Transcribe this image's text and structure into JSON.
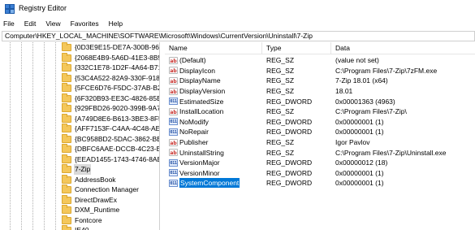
{
  "window": {
    "title": "Registry Editor"
  },
  "menu": [
    "File",
    "Edit",
    "View",
    "Favorites",
    "Help"
  ],
  "address": "Computer\\HKEY_LOCAL_MACHINE\\SOFTWARE\\Microsoft\\Windows\\CurrentVersion\\Uninstall\\7-Zip",
  "tree": {
    "items": [
      {
        "label": "{0D3E9E15-DE7A-300B-96F",
        "selected": false
      },
      {
        "label": "{2068E4B9-5A6D-41E3-8B50",
        "selected": false
      },
      {
        "label": "{332C1E78-1D2F-4A64-B718",
        "selected": false
      },
      {
        "label": "{53C4A522-82A9-330F-9187",
        "selected": false
      },
      {
        "label": "{5FCE6D76-F5DC-37AB-B2EE",
        "selected": false
      },
      {
        "label": "{6F320B93-EE3C-4826-85E0",
        "selected": false
      },
      {
        "label": "{929FBD26-9020-399B-9A7A",
        "selected": false
      },
      {
        "label": "{A749D8E6-B613-3BE3-8F5F",
        "selected": false
      },
      {
        "label": "{AFF7153F-C4AA-4C48-AEE",
        "selected": false
      },
      {
        "label": "{BC958BD2-5DAC-3862-BB1",
        "selected": false
      },
      {
        "label": "{DBFC6AAE-DCCB-4C23-B0",
        "selected": false
      },
      {
        "label": "{EEAD1455-1743-4746-8AEA",
        "selected": false
      },
      {
        "label": "7-Zip",
        "selected": true
      },
      {
        "label": "AddressBook",
        "selected": false
      },
      {
        "label": "Connection Manager",
        "selected": false
      },
      {
        "label": "DirectDrawEx",
        "selected": false
      },
      {
        "label": "DXM_Runtime",
        "selected": false
      },
      {
        "label": "Fontcore",
        "selected": false
      },
      {
        "label": "IE40",
        "selected": false
      }
    ]
  },
  "list": {
    "columns": {
      "name": "Name",
      "type": "Type",
      "data": "Data"
    },
    "rows": [
      {
        "icon": "string-value-icon",
        "name": "(Default)",
        "type": "REG_SZ",
        "data": "(value not set)",
        "selected": false
      },
      {
        "icon": "string-value-icon",
        "name": "DisplayIcon",
        "type": "REG_SZ",
        "data": "C:\\Program Files\\7-Zip\\7zFM.exe",
        "selected": false
      },
      {
        "icon": "string-value-icon",
        "name": "DisplayName",
        "type": "REG_SZ",
        "data": "7-Zip 18.01 (x64)",
        "selected": false
      },
      {
        "icon": "string-value-icon",
        "name": "DisplayVersion",
        "type": "REG_SZ",
        "data": "18.01",
        "selected": false
      },
      {
        "icon": "dword-value-icon",
        "name": "EstimatedSize",
        "type": "REG_DWORD",
        "data": "0x00001363 (4963)",
        "selected": false
      },
      {
        "icon": "string-value-icon",
        "name": "InstallLocation",
        "type": "REG_SZ",
        "data": "C:\\Program Files\\7-Zip\\",
        "selected": false
      },
      {
        "icon": "dword-value-icon",
        "name": "NoModify",
        "type": "REG_DWORD",
        "data": "0x00000001 (1)",
        "selected": false
      },
      {
        "icon": "dword-value-icon",
        "name": "NoRepair",
        "type": "REG_DWORD",
        "data": "0x00000001 (1)",
        "selected": false
      },
      {
        "icon": "string-value-icon",
        "name": "Publisher",
        "type": "REG_SZ",
        "data": "Igor Pavlov",
        "selected": false
      },
      {
        "icon": "string-value-icon",
        "name": "UninstallString",
        "type": "REG_SZ",
        "data": "C:\\Program Files\\7-Zip\\Uninstall.exe",
        "selected": false
      },
      {
        "icon": "dword-value-icon",
        "name": "VersionMajor",
        "type": "REG_DWORD",
        "data": "0x00000012 (18)",
        "selected": false
      },
      {
        "icon": "dword-value-icon",
        "name": "VersionMinor",
        "type": "REG_DWORD",
        "data": "0x00000001 (1)",
        "selected": false
      },
      {
        "icon": "dword-value-icon",
        "name": "SystemComponent",
        "type": "REG_DWORD",
        "data": "0x00000001 (1)",
        "selected": true
      }
    ]
  },
  "colors": {
    "selection": "#0078d7",
    "folder": "#f4c75b",
    "string_icon": "#c8302c",
    "dword_icon": "#1f4ea3"
  }
}
